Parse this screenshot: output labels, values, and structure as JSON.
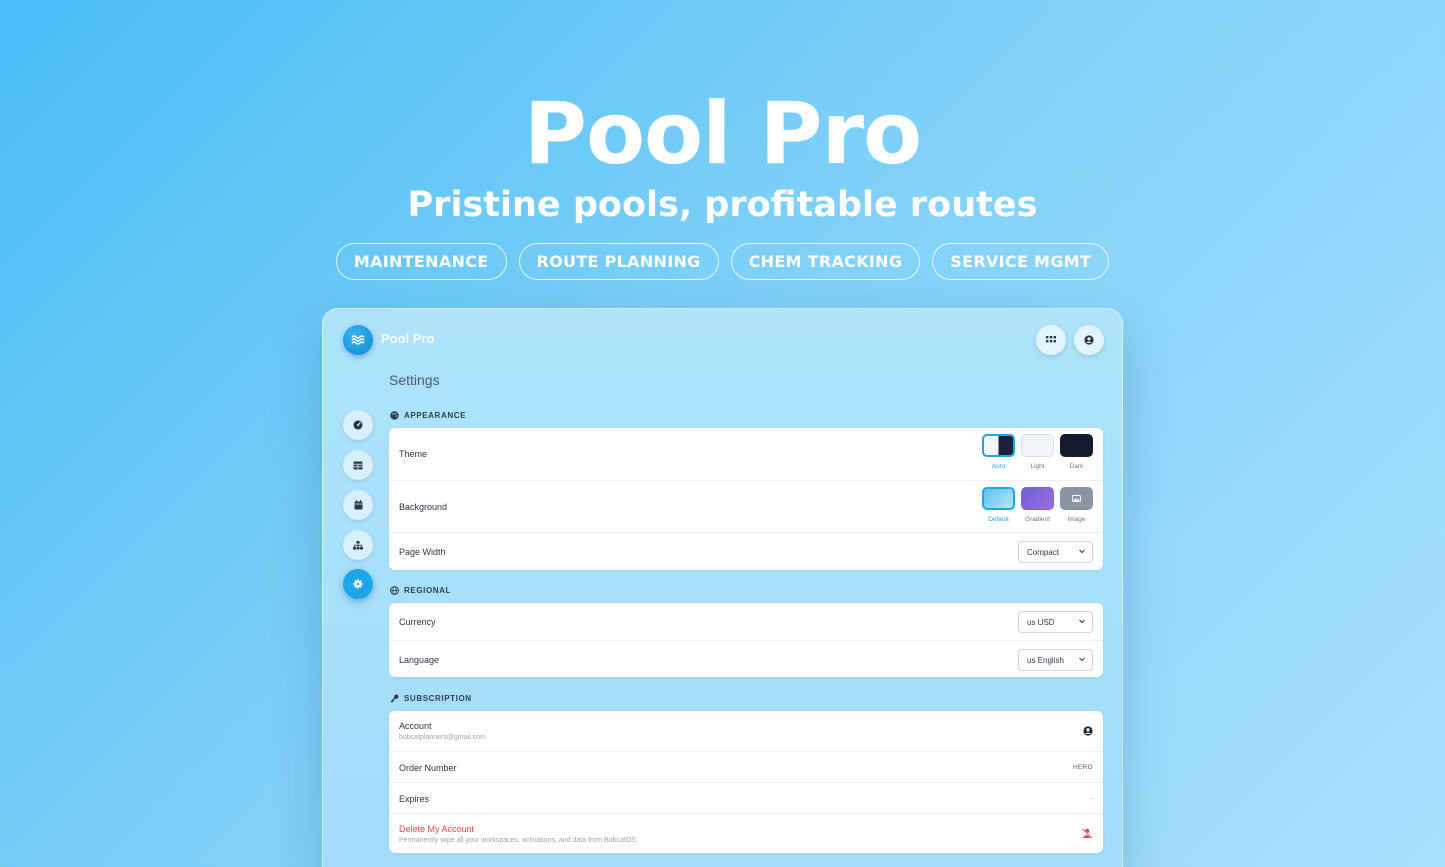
{
  "hero": {
    "title": "Pool Pro",
    "subtitle": "Pristine pools, profitable routes",
    "tags": [
      "MAINTENANCE",
      "ROUTE PLANNING",
      "CHEM TRACKING",
      "SERVICE MGMT"
    ]
  },
  "app": {
    "name": "Pool Pro",
    "page_title": "Settings",
    "top_actions": [
      {
        "icon": "grid-icon"
      },
      {
        "icon": "user-circle-icon"
      }
    ],
    "sidebar": [
      {
        "icon": "dashboard-icon",
        "active": false
      },
      {
        "icon": "table-icon",
        "active": false
      },
      {
        "icon": "calendar-icon",
        "active": false
      },
      {
        "icon": "sitemap-icon",
        "active": false
      },
      {
        "icon": "gear-icon",
        "active": true
      }
    ],
    "appearance": {
      "header": "APPEARANCE",
      "theme_label": "Theme",
      "theme_options": [
        "Auto",
        "Light",
        "Dark"
      ],
      "theme_selected": "Auto",
      "background_label": "Background",
      "background_options": [
        "Default",
        "Gradient",
        "Image"
      ],
      "background_selected": "Default",
      "page_width_label": "Page Width",
      "page_width_value": "Compact"
    },
    "regional": {
      "header": "REGIONAL",
      "currency_label": "Currency",
      "currency_value": "us USD",
      "language_label": "Language",
      "language_value": "us English"
    },
    "subscription": {
      "header": "SUBSCRIPTION",
      "account_label": "Account",
      "account_email": "bobcatplanners@gmail.com",
      "order_label": "Order Number",
      "order_value": "HERO",
      "expires_label": "Expires",
      "expires_value": "-",
      "delete_label": "Delete My Account",
      "delete_desc": "Permanently wipe all your workspaces, activations, and data from BobcatOS."
    },
    "colors": {
      "accent": "#1ea6ea",
      "danger": "#e5484d"
    }
  }
}
